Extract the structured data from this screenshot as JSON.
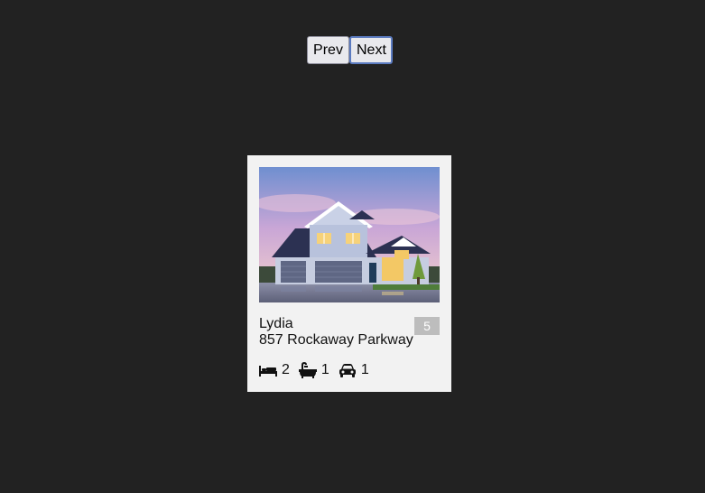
{
  "pager": {
    "prev_label": "Prev",
    "next_label": "Next"
  },
  "listing": {
    "name": "Lydia",
    "address": "857 Rockaway Parkway",
    "badge": "5",
    "features": [
      {
        "icon": "bed-icon",
        "value": "2"
      },
      {
        "icon": "bathtub-icon",
        "value": "1"
      },
      {
        "icon": "car-icon",
        "value": "1"
      }
    ]
  },
  "colors": {
    "page_background": "#222222",
    "card_background": "#f2f2f2",
    "badge_background": "#bdbdbd",
    "focus_ring": "#5b7bc0"
  }
}
